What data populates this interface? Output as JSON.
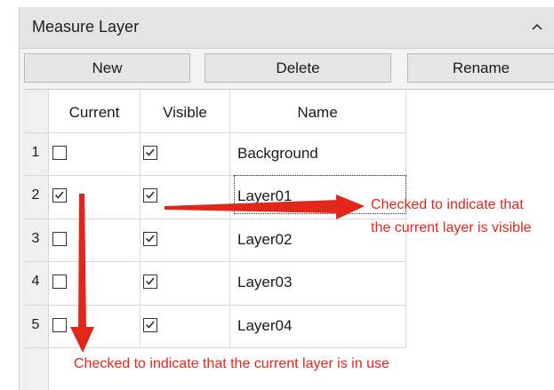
{
  "panel": {
    "title": "Measure Layer",
    "collapse_icon": "chevron-up-icon"
  },
  "toolbar": {
    "new_label": "New",
    "delete_label": "Delete",
    "rename_label": "Rename"
  },
  "table": {
    "columns": [
      "Current",
      "Visible",
      "Name"
    ],
    "rows": [
      {
        "num": "1",
        "current": false,
        "visible": true,
        "name": "Background"
      },
      {
        "num": "2",
        "current": true,
        "visible": true,
        "name": "Layer01"
      },
      {
        "num": "3",
        "current": false,
        "visible": true,
        "name": "Layer02"
      },
      {
        "num": "4",
        "current": false,
        "visible": true,
        "name": "Layer03"
      },
      {
        "num": "5",
        "current": false,
        "visible": true,
        "name": "Layer04"
      }
    ]
  },
  "annotations": {
    "visible_note_line1": "Checked to indicate that",
    "visible_note_line2": "the current layer is visible",
    "current_note": "Checked to indicate that the current layer is in use",
    "color": "#e1261c"
  }
}
